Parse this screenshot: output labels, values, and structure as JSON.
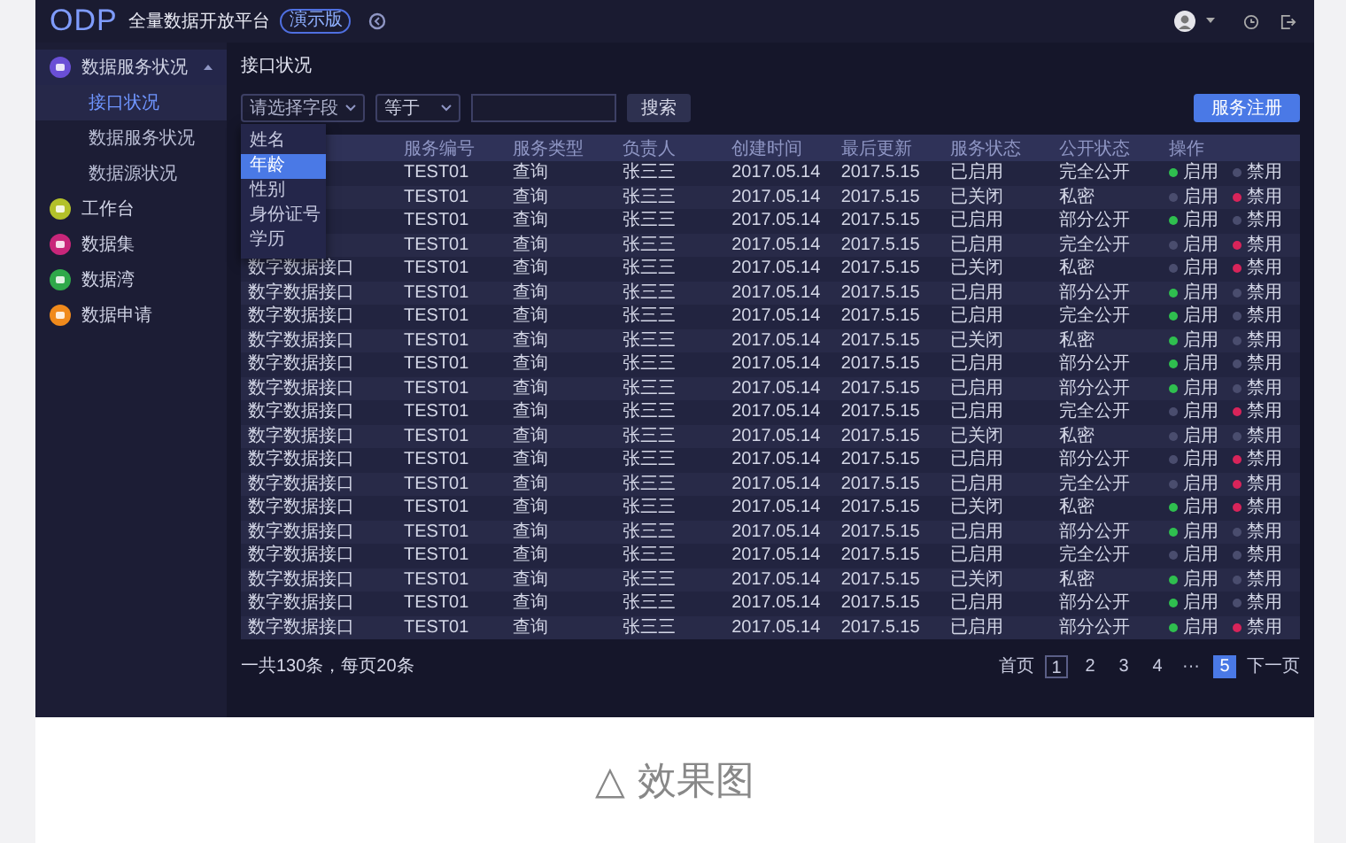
{
  "header": {
    "logo": "ODP",
    "title": "全量数据开放平台",
    "badge": "演示版"
  },
  "sidebar": {
    "items": [
      {
        "label": "数据服务状况",
        "color": "#6a4fd6",
        "expanded": true,
        "children": [
          {
            "label": "接口状况",
            "selected": true
          },
          {
            "label": "数据服务状况",
            "selected": false
          },
          {
            "label": "数据源状况",
            "selected": false
          }
        ]
      },
      {
        "label": "工作台",
        "color": "#b3c12a"
      },
      {
        "label": "数据集",
        "color": "#c8267a"
      },
      {
        "label": "数据湾",
        "color": "#2fa84a"
      },
      {
        "label": "数据申请",
        "color": "#f08a1c"
      }
    ]
  },
  "page_title": "接口状况",
  "filters": {
    "field": {
      "placeholder": "请选择字段"
    },
    "operator": {
      "value": "等于"
    },
    "search_button": "搜索"
  },
  "field_menu": {
    "options": [
      {
        "label": "姓名",
        "selected": false
      },
      {
        "label": "年龄",
        "selected": true
      },
      {
        "label": "性别",
        "selected": false
      },
      {
        "label": "身份证号",
        "selected": false
      },
      {
        "label": "学历",
        "selected": false
      }
    ]
  },
  "register_button": "服务注册",
  "table": {
    "columns": [
      "服务编号",
      "服务类型",
      "负责人",
      "创建时间",
      "最后更新",
      "服务状态",
      "公开状态",
      "操作"
    ],
    "rows": [
      {
        "code": "TEST01",
        "type": "查询",
        "owner": "张三三",
        "created": "2017.05.14",
        "updated": "2017.5.15",
        "status": "已启用",
        "visibility": "完全公开",
        "actions": [
          {
            "kind": "enable",
            "label": "启用",
            "active": true
          },
          {
            "kind": "disable",
            "label": "禁用",
            "active": false
          }
        ]
      },
      {
        "code": "TEST01",
        "type": "查询",
        "owner": "张三三",
        "created": "2017.05.14",
        "updated": "2017.5.15",
        "status": "已关闭",
        "visibility": "私密",
        "actions": [
          {
            "kind": "enable",
            "label": "启用",
            "active": false
          },
          {
            "kind": "disable",
            "label": "禁用",
            "active": true
          }
        ]
      },
      {
        "code": "TEST01",
        "type": "查询",
        "owner": "张三三",
        "created": "2017.05.14",
        "updated": "2017.5.15",
        "status": "已启用",
        "visibility": "部分公开",
        "actions": [
          {
            "kind": "enable",
            "label": "启用",
            "active": true
          },
          {
            "kind": "disable",
            "label": "禁用",
            "active": false
          }
        ]
      },
      {
        "code": "TEST01",
        "type": "查询",
        "owner": "张三三",
        "created": "2017.05.14",
        "updated": "2017.5.15",
        "status": "已启用",
        "visibility": "完全公开",
        "actions": [
          {
            "kind": "enable",
            "label": "启用",
            "active": false
          },
          {
            "kind": "disable",
            "label": "禁用",
            "active": true
          }
        ]
      },
      {
        "name": "数字数据接口",
        "code": "TEST01",
        "type": "查询",
        "owner": "张三三",
        "created": "2017.05.14",
        "updated": "2017.5.15",
        "status": "已关闭",
        "visibility": "私密",
        "actions": [
          {
            "kind": "enable",
            "label": "启用",
            "active": false
          },
          {
            "kind": "disable",
            "label": "禁用",
            "active": true
          }
        ]
      },
      {
        "name": "数字数据接口",
        "code": "TEST01",
        "type": "查询",
        "owner": "张三三",
        "created": "2017.05.14",
        "updated": "2017.5.15",
        "status": "已启用",
        "visibility": "部分公开",
        "actions": [
          {
            "kind": "enable",
            "label": "启用",
            "active": true
          },
          {
            "kind": "disable",
            "label": "禁用",
            "active": false
          }
        ]
      },
      {
        "name": "数字数据接口",
        "code": "TEST01",
        "type": "查询",
        "owner": "张三三",
        "created": "2017.05.14",
        "updated": "2017.5.15",
        "status": "已启用",
        "visibility": "完全公开",
        "actions": [
          {
            "kind": "enable",
            "label": "启用",
            "active": true
          },
          {
            "kind": "disable",
            "label": "禁用",
            "active": false
          }
        ]
      },
      {
        "name": "数字数据接口",
        "code": "TEST01",
        "type": "查询",
        "owner": "张三三",
        "created": "2017.05.14",
        "updated": "2017.5.15",
        "status": "已关闭",
        "visibility": "私密",
        "actions": [
          {
            "kind": "enable",
            "label": "启用",
            "active": true
          },
          {
            "kind": "disable",
            "label": "禁用",
            "active": false
          }
        ]
      },
      {
        "name": "数字数据接口",
        "code": "TEST01",
        "type": "查询",
        "owner": "张三三",
        "created": "2017.05.14",
        "updated": "2017.5.15",
        "status": "已启用",
        "visibility": "部分公开",
        "actions": [
          {
            "kind": "enable",
            "label": "启用",
            "active": true
          },
          {
            "kind": "disable",
            "label": "禁用",
            "active": false
          }
        ]
      },
      {
        "name": "数字数据接口",
        "code": "TEST01",
        "type": "查询",
        "owner": "张三三",
        "created": "2017.05.14",
        "updated": "2017.5.15",
        "status": "已启用",
        "visibility": "部分公开",
        "actions": [
          {
            "kind": "enable",
            "label": "启用",
            "active": true
          },
          {
            "kind": "disable",
            "label": "禁用",
            "active": false
          }
        ]
      },
      {
        "name": "数字数据接口",
        "code": "TEST01",
        "type": "查询",
        "owner": "张三三",
        "created": "2017.05.14",
        "updated": "2017.5.15",
        "status": "已启用",
        "visibility": "完全公开",
        "actions": [
          {
            "kind": "enable",
            "label": "启用",
            "active": false
          },
          {
            "kind": "disable",
            "label": "禁用",
            "active": true
          }
        ]
      },
      {
        "name": "数字数据接口",
        "code": "TEST01",
        "type": "查询",
        "owner": "张三三",
        "created": "2017.05.14",
        "updated": "2017.5.15",
        "status": "已关闭",
        "visibility": "私密",
        "actions": [
          {
            "kind": "enable",
            "label": "启用",
            "active": false
          },
          {
            "kind": "disable",
            "label": "禁用",
            "active": false
          }
        ]
      },
      {
        "name": "数字数据接口",
        "code": "TEST01",
        "type": "查询",
        "owner": "张三三",
        "created": "2017.05.14",
        "updated": "2017.5.15",
        "status": "已启用",
        "visibility": "部分公开",
        "actions": [
          {
            "kind": "enable",
            "label": "启用",
            "active": false
          },
          {
            "kind": "disable",
            "label": "禁用",
            "active": true
          }
        ]
      },
      {
        "name": "数字数据接口",
        "code": "TEST01",
        "type": "查询",
        "owner": "张三三",
        "created": "2017.05.14",
        "updated": "2017.5.15",
        "status": "已启用",
        "visibility": "完全公开",
        "actions": [
          {
            "kind": "enable",
            "label": "启用",
            "active": false
          },
          {
            "kind": "disable",
            "label": "禁用",
            "active": true
          }
        ]
      },
      {
        "name": "数字数据接口",
        "code": "TEST01",
        "type": "查询",
        "owner": "张三三",
        "created": "2017.05.14",
        "updated": "2017.5.15",
        "status": "已关闭",
        "visibility": "私密",
        "actions": [
          {
            "kind": "enable",
            "label": "启用",
            "active": true
          },
          {
            "kind": "disable",
            "label": "禁用",
            "active": true
          }
        ]
      },
      {
        "name": "数字数据接口",
        "code": "TEST01",
        "type": "查询",
        "owner": "张三三",
        "created": "2017.05.14",
        "updated": "2017.5.15",
        "status": "已启用",
        "visibility": "部分公开",
        "actions": [
          {
            "kind": "enable",
            "label": "启用",
            "active": true
          },
          {
            "kind": "disable",
            "label": "禁用",
            "active": false
          }
        ]
      },
      {
        "name": "数字数据接口",
        "code": "TEST01",
        "type": "查询",
        "owner": "张三三",
        "created": "2017.05.14",
        "updated": "2017.5.15",
        "status": "已启用",
        "visibility": "完全公开",
        "actions": [
          {
            "kind": "enable",
            "label": "启用",
            "active": false
          },
          {
            "kind": "disable",
            "label": "禁用",
            "active": false
          }
        ]
      },
      {
        "name": "数字数据接口",
        "code": "TEST01",
        "type": "查询",
        "owner": "张三三",
        "created": "2017.05.14",
        "updated": "2017.5.15",
        "status": "已关闭",
        "visibility": "私密",
        "actions": [
          {
            "kind": "enable",
            "label": "启用",
            "active": true
          },
          {
            "kind": "disable",
            "label": "禁用",
            "active": false
          }
        ]
      },
      {
        "name": "数字数据接口",
        "code": "TEST01",
        "type": "查询",
        "owner": "张三三",
        "created": "2017.05.14",
        "updated": "2017.5.15",
        "status": "已启用",
        "visibility": "部分公开",
        "actions": [
          {
            "kind": "enable",
            "label": "启用",
            "active": true
          },
          {
            "kind": "disable",
            "label": "禁用",
            "active": false
          }
        ]
      },
      {
        "name": "数字数据接口",
        "code": "TEST01",
        "type": "查询",
        "owner": "张三三",
        "created": "2017.05.14",
        "updated": "2017.5.15",
        "status": "已启用",
        "visibility": "部分公开",
        "actions": [
          {
            "kind": "enable",
            "label": "启用",
            "active": true
          },
          {
            "kind": "disable",
            "label": "禁用",
            "active": true
          }
        ]
      }
    ]
  },
  "footer": {
    "total": "一共130条，每页20条",
    "pagination": {
      "first": "首页",
      "pages": [
        {
          "kind": "page",
          "label": "1",
          "outlined": true,
          "selected": false
        },
        {
          "kind": "page",
          "label": "2",
          "outlined": false,
          "selected": false
        },
        {
          "kind": "page",
          "label": "3",
          "outlined": false,
          "selected": false
        },
        {
          "kind": "page",
          "label": "4",
          "outlined": false,
          "selected": false
        },
        {
          "kind": "ellipsis",
          "label": "···"
        },
        {
          "kind": "page",
          "label": "5",
          "outlined": false,
          "selected": true
        }
      ],
      "next": "下一页"
    }
  },
  "caption": "△ 效果图"
}
